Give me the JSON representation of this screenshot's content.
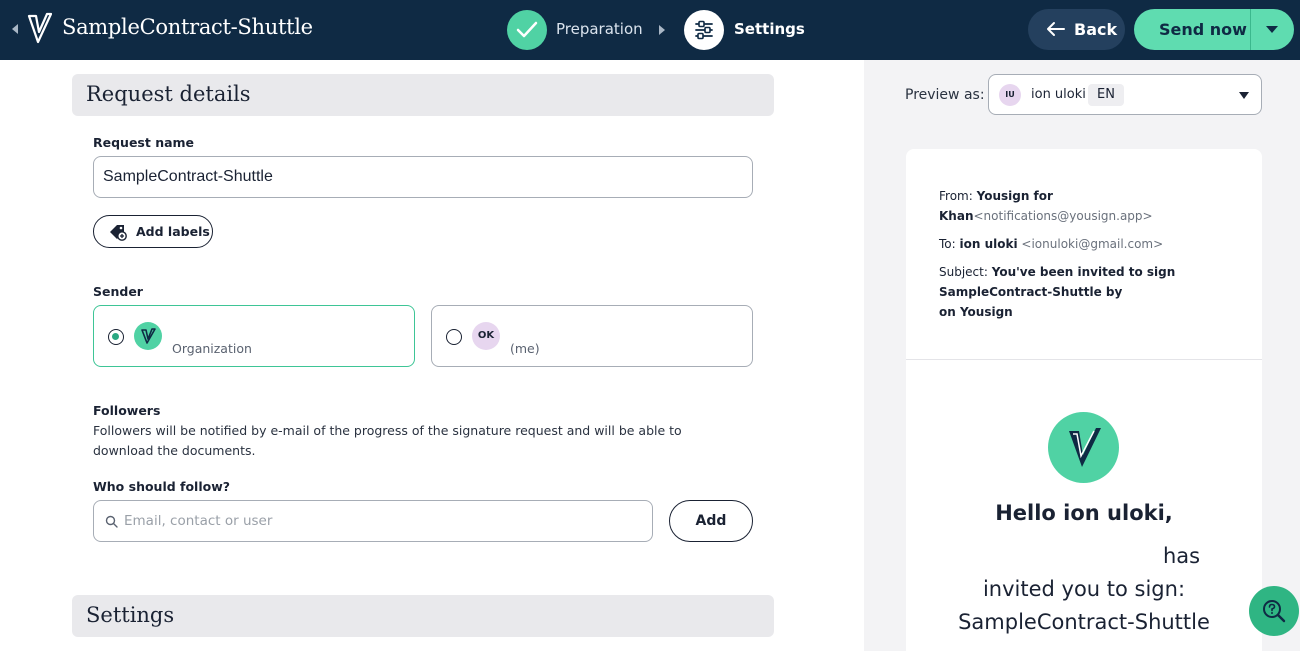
{
  "header": {
    "title": "SampleContract-Shuttle",
    "steps": [
      {
        "label": "Preparation",
        "state": "done"
      },
      {
        "label": "Settings",
        "state": "current"
      }
    ],
    "back_label": "Back",
    "send_label": "Send now"
  },
  "request_details": {
    "section_title": "Request details",
    "name_label": "Request name",
    "name_value": "SampleContract-Shuttle",
    "add_labels_label": "Add labels"
  },
  "sender": {
    "label": "Sender",
    "options": [
      {
        "initials": "",
        "subtitle": "Organization",
        "selected": true
      },
      {
        "initials": "OK",
        "subtitle": "(me)",
        "selected": false
      }
    ]
  },
  "followers": {
    "title": "Followers",
    "description": "Followers will be notified by e-mail of the progress of the signature request and will be able to download the documents.",
    "who_label": "Who should follow?",
    "input_placeholder": "Email, contact or user",
    "add_label": "Add"
  },
  "settings": {
    "section_title": "Settings"
  },
  "preview": {
    "label": "Preview as:",
    "recipient_initials": "IU",
    "recipient_name": "ion uloki",
    "language": "EN",
    "email": {
      "from_label": "From:",
      "from_name_line1": "Yousign for",
      "from_name_line2": "Khan",
      "from_address": "<notifications@yousign.app>",
      "to_label": "To:",
      "to_name": "ion uloki",
      "to_address": "<ionuloki@gmail.com>",
      "subject_label": "Subject:",
      "subject_line1": "You've been invited to sign",
      "subject_line2": "SampleContract-Shuttle by",
      "subject_line3": "on Yousign",
      "greeting": "Hello ion uloki,",
      "body_has": "has",
      "body_invited": "invited you to sign:",
      "body_document": "SampleContract-Shuttle"
    }
  },
  "colors": {
    "topbar": "#0f2a44",
    "accent_green": "#50d2a4",
    "send_button": "#5fdcb0",
    "back_button": "#24405e"
  }
}
